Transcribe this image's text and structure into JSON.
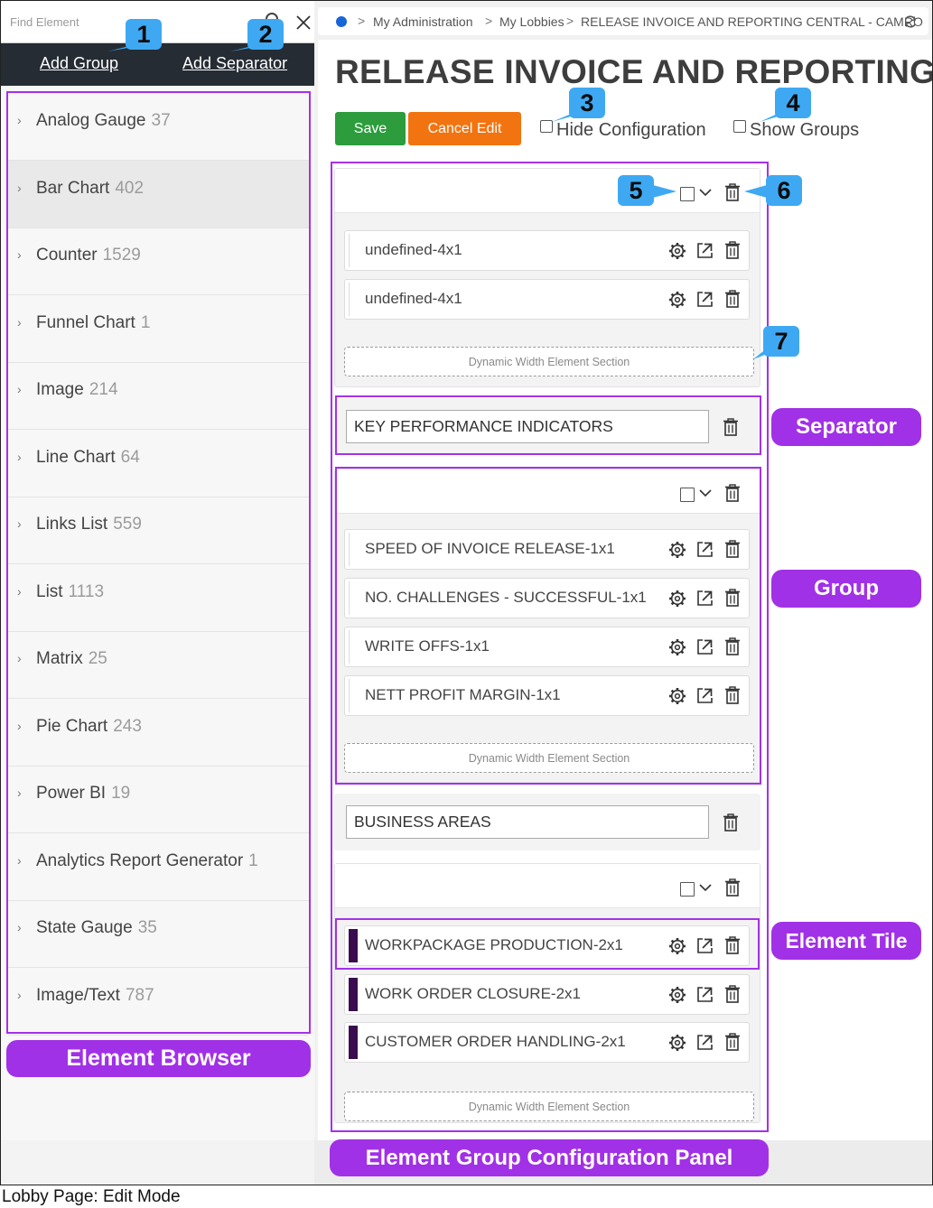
{
  "finder": {
    "placeholder": "Find Element"
  },
  "toolbar": {
    "add_group": "Add Group",
    "add_separator": "Add Separator"
  },
  "elements": [
    {
      "name": "Analog Gauge",
      "count": "37"
    },
    {
      "name": "Bar Chart",
      "count": "402",
      "highlighted": true
    },
    {
      "name": "Counter",
      "count": "1529"
    },
    {
      "name": "Funnel Chart",
      "count": "1"
    },
    {
      "name": "Image",
      "count": "214"
    },
    {
      "name": "Line Chart",
      "count": "64"
    },
    {
      "name": "Links List",
      "count": "559"
    },
    {
      "name": "List",
      "count": "1113"
    },
    {
      "name": "Matrix",
      "count": "25"
    },
    {
      "name": "Pie Chart",
      "count": "243"
    },
    {
      "name": "Power BI",
      "count": "19"
    },
    {
      "name": "Analytics Report Generator",
      "count": "1"
    },
    {
      "name": "State Gauge",
      "count": "35"
    },
    {
      "name": "Image/Text",
      "count": "787"
    }
  ],
  "breadcrumb": {
    "items": [
      "My Administration",
      "My Lobbies",
      "RELEASE INVOICE AND REPORTING CENTRAL - CAMRO"
    ],
    "separator": ">"
  },
  "page": {
    "title": "RELEASE INVOICE AND REPORTING ...",
    "save_label": "Save",
    "cancel_label": "Cancel Edit",
    "hide_config_label": "Hide Configuration",
    "show_groups_label": "Show Groups"
  },
  "config": {
    "groups": [
      {
        "tiles": [
          "undefined-4x1",
          "undefined-4x1"
        ],
        "dynamic_label": "Dynamic Width Element Section"
      },
      {
        "tiles": [
          "SPEED OF INVOICE RELEASE-1x1",
          "NO. CHALLENGES - SUCCESSFUL-1x1",
          "WRITE OFFS-1x1",
          "NETT PROFIT MARGIN-1x1"
        ],
        "dynamic_label": "Dynamic Width Element Section"
      },
      {
        "tiles": [
          "WORKPACKAGE PRODUCTION-2x1",
          "WORK ORDER CLOSURE-2x1",
          "CUSTOMER ORDER HANDLING-2x1"
        ],
        "dynamic_label": "Dynamic Width Element Section"
      }
    ],
    "separators": [
      "KEY PERFORMANCE INDICATORS",
      "BUSINESS AREAS"
    ]
  },
  "annotations": {
    "callouts": [
      "1",
      "2",
      "3",
      "4",
      "5",
      "6",
      "7"
    ],
    "tags": {
      "element_browser": "Element Browser",
      "separator": "Separator",
      "group": "Group",
      "element_tile": "Element Tile",
      "config_panel": "Element Group Configuration Panel"
    },
    "caption": "Lobby Page: Edit Mode",
    "tag_color": "#a131e6",
    "callout_color": "#3ea9f2",
    "tile_marker_color": "#3a0c4f"
  }
}
